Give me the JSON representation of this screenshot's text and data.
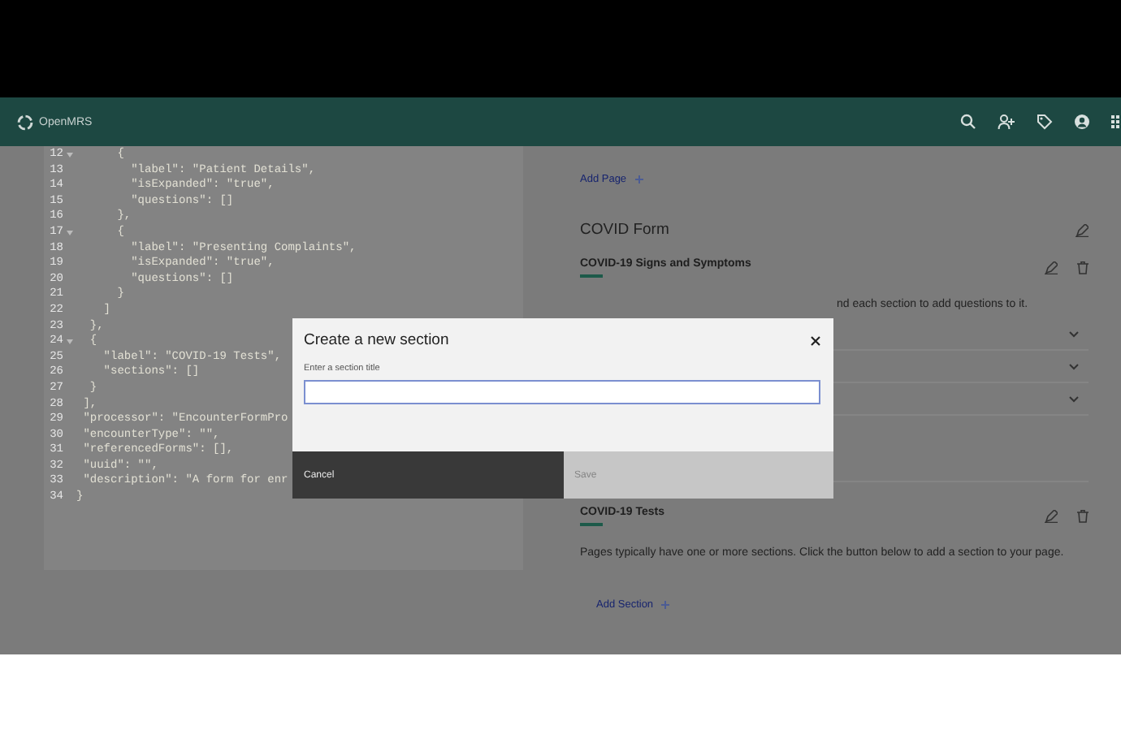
{
  "header": {
    "brand": "OpenMRS"
  },
  "editor": {
    "lines": [
      {
        "number": "12",
        "fold": true,
        "text": "      {"
      },
      {
        "number": "13",
        "fold": false,
        "text": "        \"label\": \"Patient Details\","
      },
      {
        "number": "14",
        "fold": false,
        "text": "        \"isExpanded\": \"true\","
      },
      {
        "number": "15",
        "fold": false,
        "text": "        \"questions\": []"
      },
      {
        "number": "16",
        "fold": false,
        "text": "      },"
      },
      {
        "number": "17",
        "fold": true,
        "text": "      {"
      },
      {
        "number": "18",
        "fold": false,
        "text": "        \"label\": \"Presenting Complaints\","
      },
      {
        "number": "19",
        "fold": false,
        "text": "        \"isExpanded\": \"true\","
      },
      {
        "number": "20",
        "fold": false,
        "text": "        \"questions\": []"
      },
      {
        "number": "21",
        "fold": false,
        "text": "      }"
      },
      {
        "number": "22",
        "fold": false,
        "text": "    ]"
      },
      {
        "number": "23",
        "fold": false,
        "text": "  },"
      },
      {
        "number": "24",
        "fold": true,
        "text": "  {"
      },
      {
        "number": "25",
        "fold": false,
        "text": "    \"label\": \"COVID-19 Tests\","
      },
      {
        "number": "26",
        "fold": false,
        "text": "    \"sections\": []"
      },
      {
        "number": "27",
        "fold": false,
        "text": "  }"
      },
      {
        "number": "28",
        "fold": false,
        "text": " ],"
      },
      {
        "number": "29",
        "fold": false,
        "text": " \"processor\": \"EncounterFormPro"
      },
      {
        "number": "30",
        "fold": false,
        "text": " \"encounterType\": \"\","
      },
      {
        "number": "31",
        "fold": false,
        "text": " \"referencedForms\": [],"
      },
      {
        "number": "32",
        "fold": false,
        "text": " \"uuid\": \"\","
      },
      {
        "number": "33",
        "fold": false,
        "text": " \"description\": \"A form for enr"
      },
      {
        "number": "34",
        "fold": false,
        "text": "}"
      }
    ]
  },
  "builder": {
    "add_page": "Add Page",
    "form_title": "COVID Form",
    "sections": [
      {
        "title": "COVID-19 Signs and Symptoms",
        "description": "nd each section to add questions to it.",
        "description_partial": true,
        "rows": [
          {
            "expanded": false
          },
          {
            "expanded": false
          },
          {
            "expanded": false
          }
        ]
      },
      {
        "title": "COVID-19 Tests",
        "description": "Pages typically have one or more sections. Click the button below to add a section to your page.",
        "description_partial": false
      }
    ],
    "add_section": "Add Section"
  },
  "modal": {
    "title": "Create a new section",
    "field_label": "Enter a section title",
    "buttons": [
      {
        "label": "Cancel",
        "kind": "secondary",
        "disabled": false
      },
      {
        "label": "Save",
        "kind": "primary",
        "disabled": true
      }
    ]
  }
}
